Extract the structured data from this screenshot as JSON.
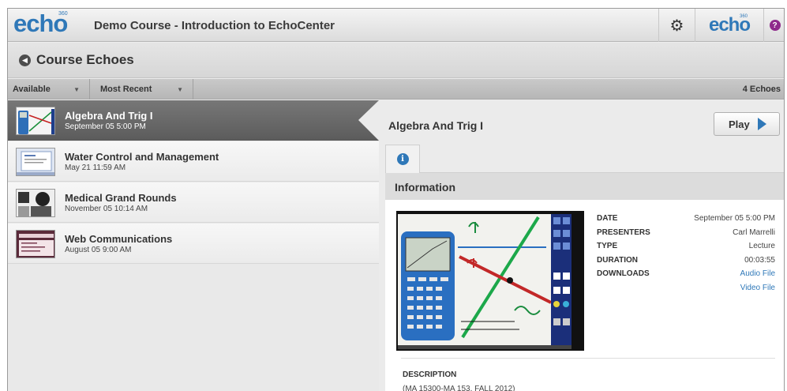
{
  "header": {
    "logo": "echo",
    "logo_sup": "360",
    "course_title": "Demo Course - Introduction to EchoCenter",
    "settings_icon": "gear-icon",
    "brand": "echo",
    "brand_sup": "360",
    "help_label": "?"
  },
  "section": {
    "title": "Course Echoes"
  },
  "filters": {
    "availability": "Available",
    "sort": "Most Recent",
    "count": "4 Echoes"
  },
  "echoes": [
    {
      "title": "Algebra And Trig I",
      "date": "September 05 5:00 PM",
      "selected": true
    },
    {
      "title": "Water Control and Management",
      "date": "May 21 11:59 AM",
      "selected": false
    },
    {
      "title": "Medical Grand Rounds",
      "date": "November 05 10:14 AM",
      "selected": false
    },
    {
      "title": "Web Communications",
      "date": "August 05 9:00 AM",
      "selected": false
    }
  ],
  "detail": {
    "title": "Algebra And Trig I",
    "play_label": "Play",
    "info_tab_icon": "info-icon",
    "info_heading": "Information",
    "meta": {
      "date_label": "DATE",
      "date_value": "September 05 5:00 PM",
      "presenters_label": "PRESENTERS",
      "presenters_value": "Carl Marrelli",
      "type_label": "TYPE",
      "type_value": "Lecture",
      "duration_label": "DURATION",
      "duration_value": "00:03:55",
      "downloads_label": "DOWNLOADS",
      "audio_link": "Audio File",
      "video_link": "Video File"
    },
    "description_label": "DESCRIPTION",
    "description_value": "(MA 15300-MA 153, FALL 2012)"
  },
  "colors": {
    "accent": "#2f78b8",
    "help": "#8e2a8b",
    "selected_row": "#5c5c5c"
  }
}
